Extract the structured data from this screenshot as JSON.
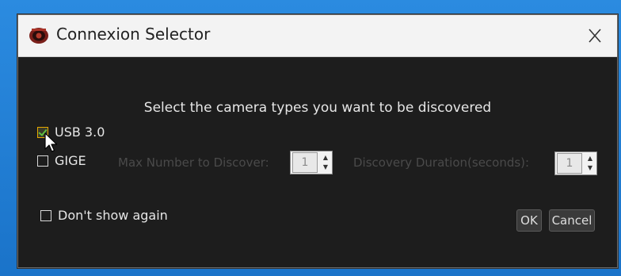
{
  "window": {
    "title": "Connexion Selector"
  },
  "dialog": {
    "prompt": "Select the camera types you want to be discovered",
    "usb_label": "USB 3.0",
    "usb_checked": true,
    "gige_label": "GIGE",
    "gige_checked": false,
    "max_discover_label": "Max Number to Discover:",
    "max_discover_value": "1",
    "duration_label": "Discovery Duration(seconds):",
    "duration_value": "1",
    "dont_show_label": "Don't show again",
    "dont_show_checked": false,
    "ok_label": "OK",
    "cancel_label": "Cancel"
  },
  "icons": {
    "app": "camera-app-icon",
    "close": "close-icon",
    "spin": "spin-arrows-icon",
    "cursor": "mouse-pointer-icon"
  },
  "colors": {
    "dialog_bg": "#1d1d1d",
    "titlebar_bg": "#f3f3f3",
    "text": "#e6e6e6",
    "disabled_text": "#4a4a4a",
    "check_mark": "#5fbf3f",
    "check_border": "#e6a800"
  }
}
